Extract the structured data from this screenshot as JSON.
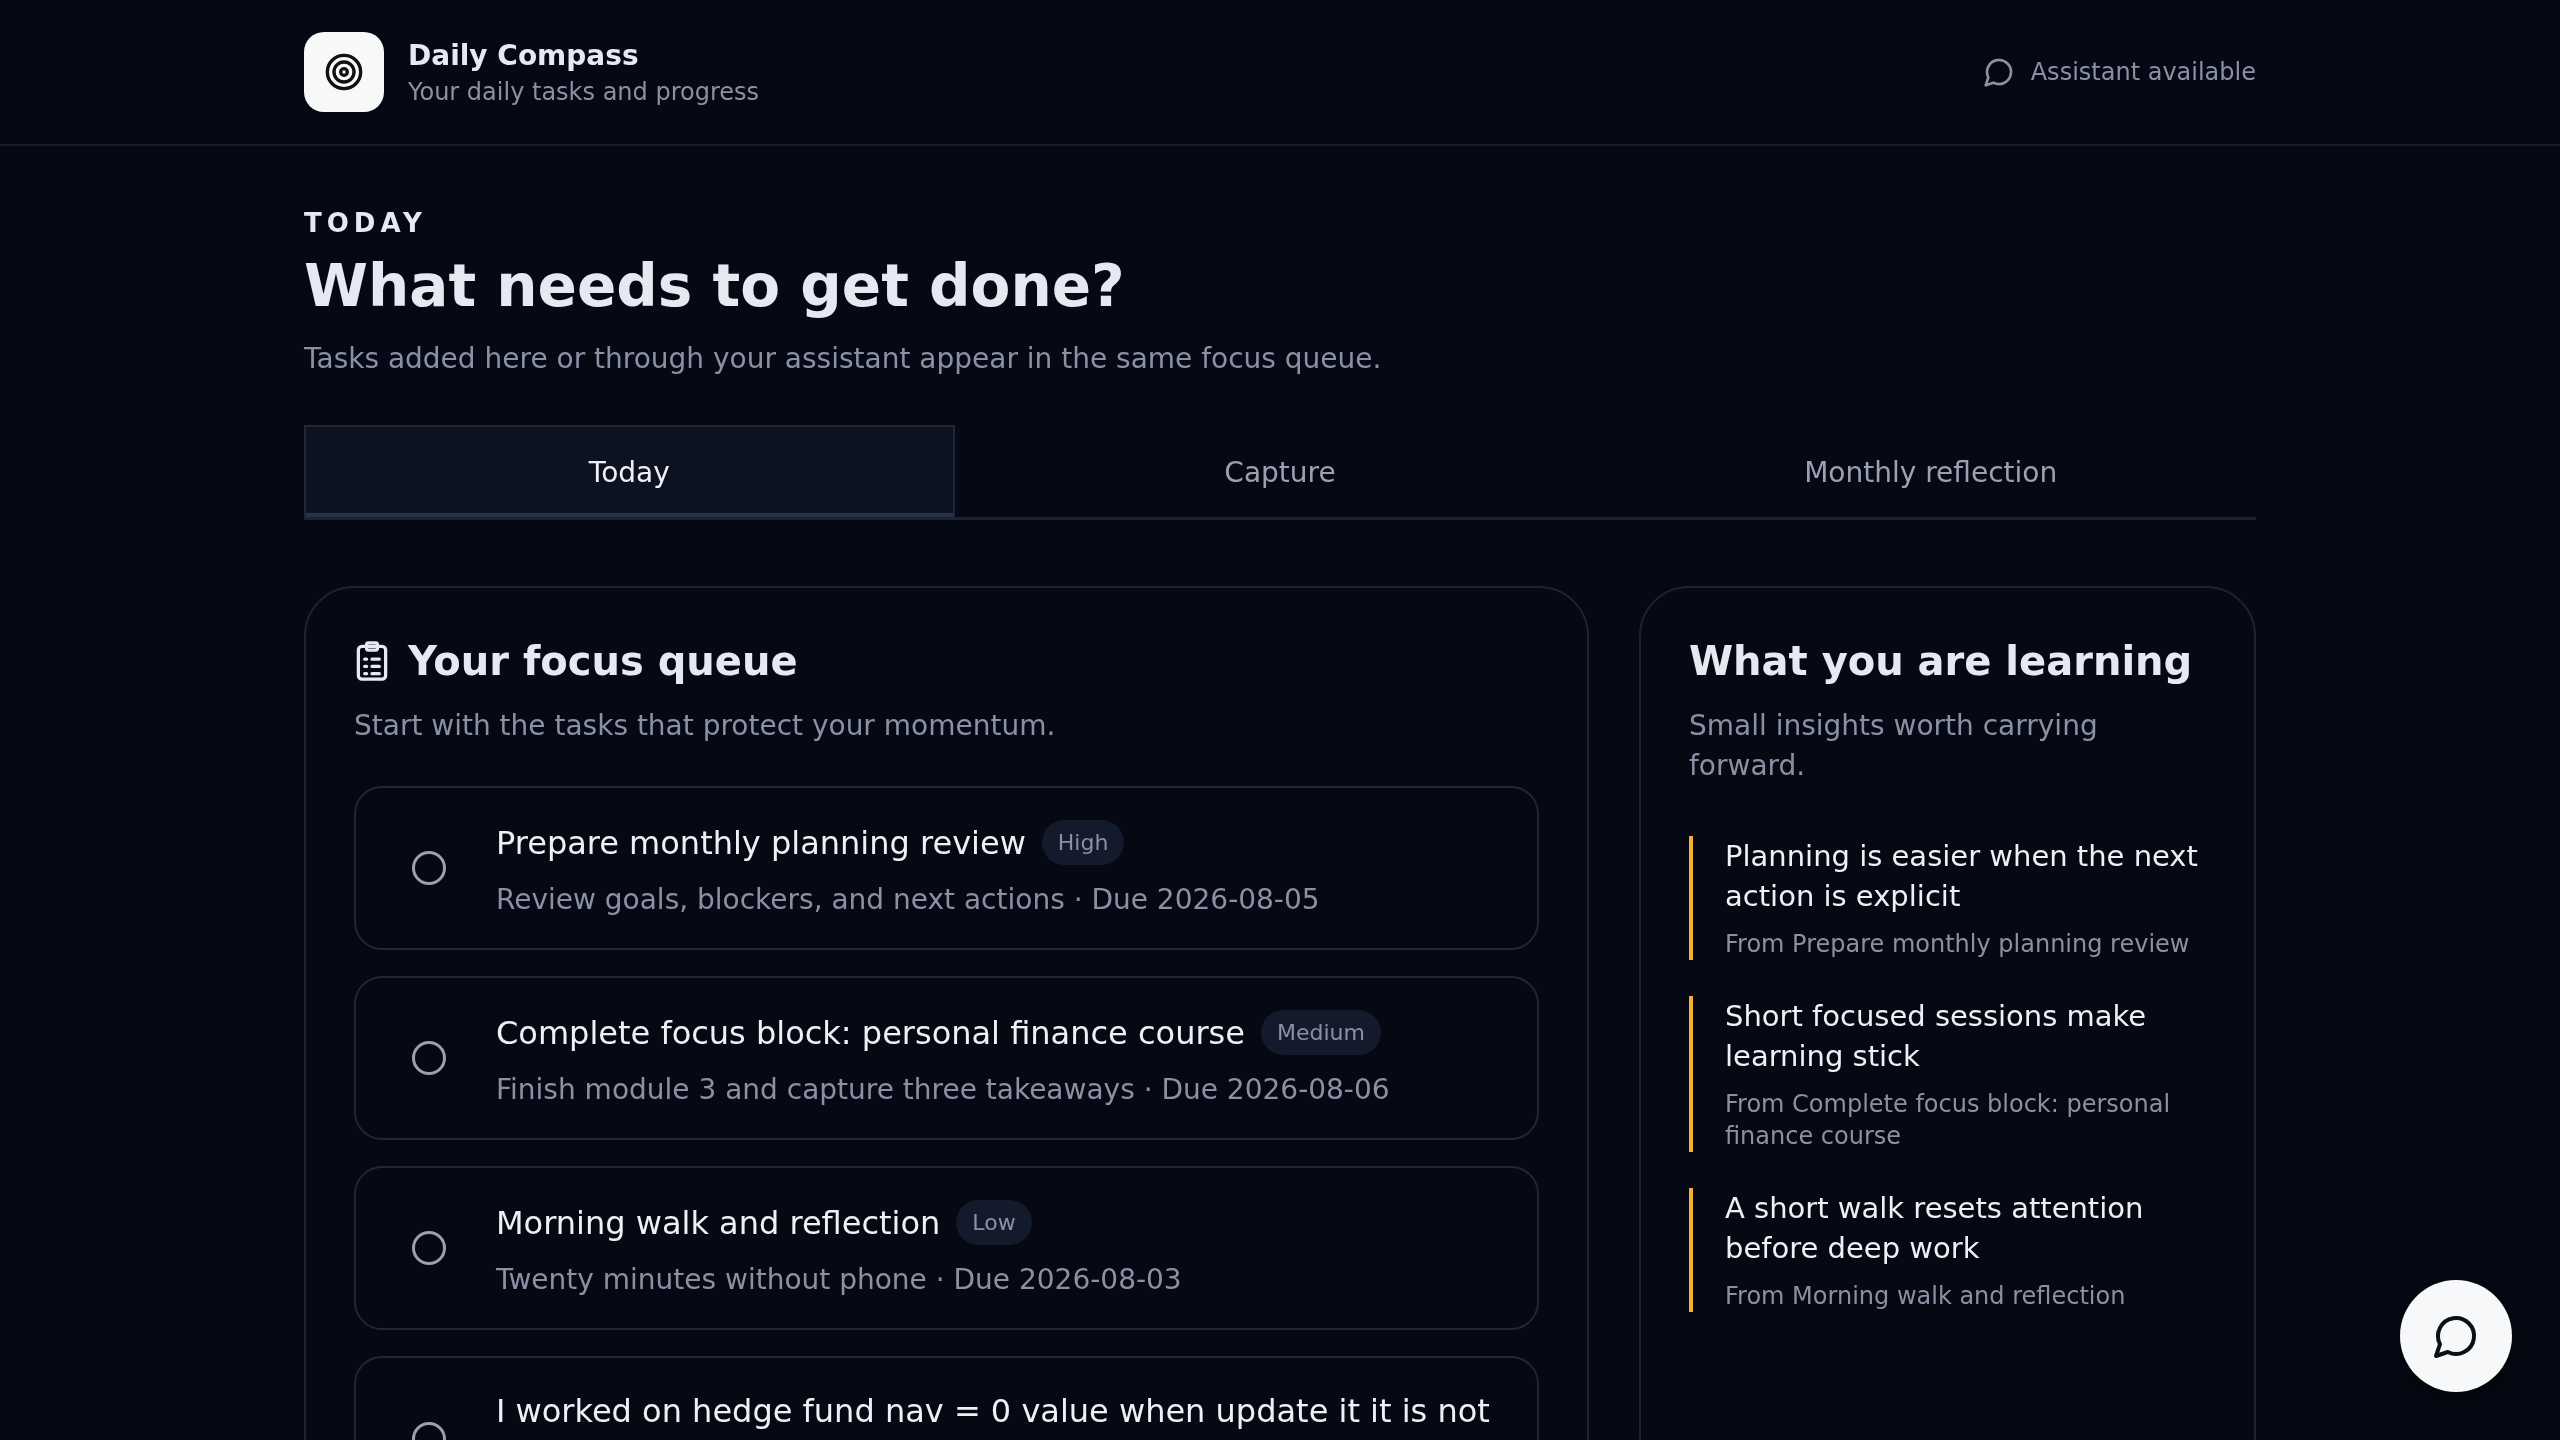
{
  "header": {
    "title": "Daily Compass",
    "subtitle": "Your daily tasks and progress",
    "status": "Assistant available"
  },
  "intro": {
    "eyebrow": "TODAY",
    "heading": "What needs to get done?",
    "description": "Tasks added here or through your assistant appear in the same focus queue."
  },
  "tabs": [
    {
      "label": "Today",
      "selected": true
    },
    {
      "label": "Capture",
      "selected": false
    },
    {
      "label": "Monthly reflection",
      "selected": false
    }
  ],
  "focus_queue": {
    "title": "Your focus queue",
    "subtitle": "Start with the tasks that protect your momentum.",
    "tasks": [
      {
        "title": "Prepare monthly planning review",
        "priority": "High",
        "detail": "Review goals, blockers, and next actions · Due 2026-08-05",
        "checked": false
      },
      {
        "title": "Complete focus block: personal finance course",
        "priority": "Medium",
        "detail": "Finish module 3 and capture three takeaways · Due 2026-08-06",
        "checked": false
      },
      {
        "title": "Morning walk and reflection",
        "priority": "Low",
        "detail": "Twenty minutes without phone · Due 2026-08-03",
        "checked": false
      },
      {
        "title": "I worked on hedge fund nav = 0 value when update it it is not",
        "checked": false
      }
    ]
  },
  "learning": {
    "title": "What you are learning",
    "subtitle": "Small insights worth carrying forward.",
    "insights": [
      {
        "text": "Planning is easier when the next action is explicit",
        "source": "From Prepare monthly planning review"
      },
      {
        "text": "Short focused sessions make learning stick",
        "source": "From Complete focus block: personal finance course"
      },
      {
        "text": "A short walk resets attention before deep work",
        "source": "From Morning walk and reflection"
      }
    ]
  }
}
